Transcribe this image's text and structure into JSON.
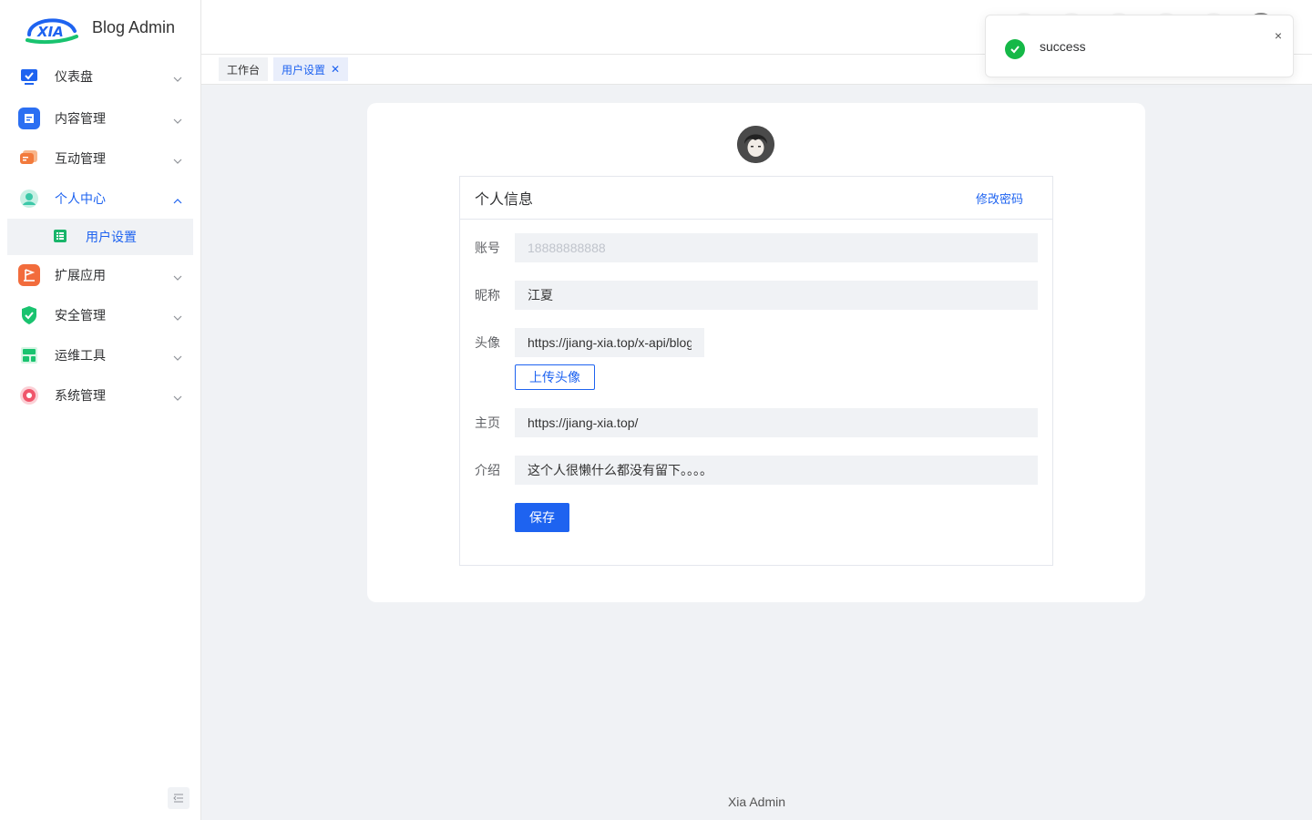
{
  "app": {
    "title": "Blog Admin",
    "logo_text": "XIA"
  },
  "sidebar": {
    "items": [
      {
        "label": "仪表盘",
        "icon": "monitor-icon",
        "color": "#1e63f0"
      },
      {
        "label": "内容管理",
        "icon": "document-icon",
        "color": "#2b6ff2"
      },
      {
        "label": "互动管理",
        "icon": "chat-bubble-icon",
        "color": "#f27a3c"
      },
      {
        "label": "个人中心",
        "icon": "user-icon",
        "color": "#3cc8a8",
        "expanded": true
      },
      {
        "label": "扩展应用",
        "icon": "flag-icon",
        "color": "#f26c3c"
      },
      {
        "label": "安全管理",
        "icon": "shield-icon",
        "color": "#19c36f"
      },
      {
        "label": "运维工具",
        "icon": "server-icon",
        "color": "#19c36f"
      },
      {
        "label": "系统管理",
        "icon": "settings-icon",
        "color": "#f0566b"
      }
    ],
    "submenu": {
      "label": "用户设置",
      "icon": "list-icon",
      "color": "#19b56a"
    }
  },
  "tabs": [
    {
      "label": "工作台",
      "active": false
    },
    {
      "label": "用户设置",
      "active": true
    }
  ],
  "profile": {
    "panel_title": "个人信息",
    "change_password": "修改密码",
    "fields": {
      "account": {
        "label": "账号",
        "placeholder": "18888888888"
      },
      "nickname": {
        "label": "昵称",
        "value": "江夏"
      },
      "avatar": {
        "label": "头像",
        "value": "https://jiang-xia.top/x-api/blog-server/static/uploads/avatar.png"
      },
      "homepage": {
        "label": "主页",
        "value": "https://jiang-xia.top/"
      },
      "intro": {
        "label": "介绍",
        "value": "这个人很懒什么都没有留下。。。。"
      }
    },
    "upload_label": "上传头像",
    "save_label": "保存"
  },
  "footer": {
    "text": "Xia Admin"
  },
  "notification": {
    "text": "success",
    "close": "×",
    "status_color": "#15b847"
  }
}
